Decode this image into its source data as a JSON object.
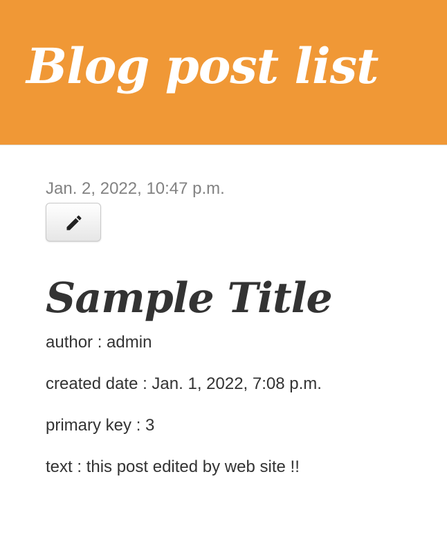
{
  "header": {
    "title": "Blog post list",
    "background_color": "#F09836"
  },
  "post": {
    "date": "Jan. 2, 2022, 10:47 p.m.",
    "edit_icon": "pencil-icon",
    "title": "Sample Title",
    "fields": [
      {
        "text": "author : admin"
      },
      {
        "text": "created date : Jan. 1, 2022, 7:08 p.m."
      },
      {
        "text": "primary key : 3"
      },
      {
        "text": "text : this post edited by web site !!"
      }
    ]
  }
}
